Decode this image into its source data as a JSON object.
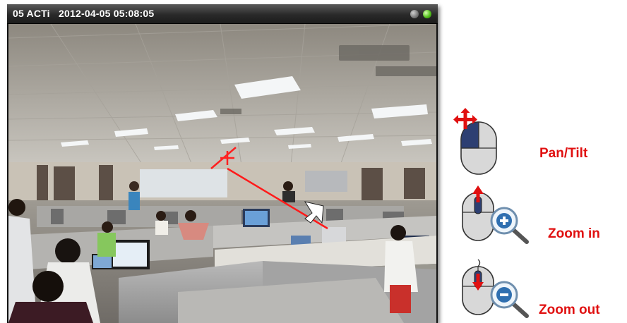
{
  "viewer": {
    "title": "05 ACTi   2012-04-05 05:08:05",
    "status_leds": [
      "gray-led",
      "green-led"
    ]
  },
  "legend": {
    "pan_tilt": {
      "label": "Pan/Tilt",
      "icon": "mouse-drag-icon"
    },
    "zoom_in": {
      "label": "Zoom in",
      "icon": "mouse-scroll-up-zoom-in-icon"
    },
    "zoom_out": {
      "label": "Zoom out",
      "icon": "mouse-scroll-down-zoom-out-icon"
    }
  },
  "colors": {
    "accent_red": "#e01010",
    "mouse_blue": "#2d3f72",
    "led_green": "#54c21d"
  }
}
